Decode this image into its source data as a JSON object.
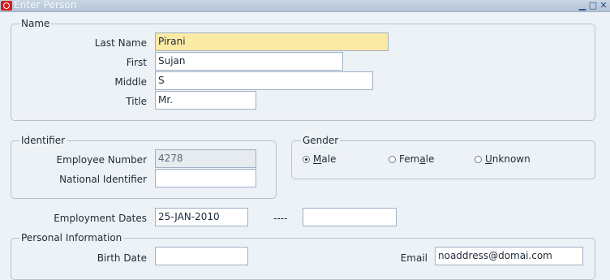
{
  "window": {
    "title": "Enter Person",
    "minimize_glyph": "▁",
    "maximize_glyph": "□",
    "close_glyph": "✕"
  },
  "name_group": {
    "legend": "Name",
    "last_name_label": "Last Name",
    "last_name_value": "Pirani",
    "first_label": "First",
    "first_value": "Sujan",
    "middle_label": "Middle",
    "middle_value": "S",
    "title_label": "Title",
    "title_value": "Mr."
  },
  "identifier_group": {
    "legend": "Identifier",
    "employee_number_label": "Employee Number",
    "employee_number_value": "4278",
    "national_identifier_label": "National Identifier",
    "national_identifier_value": ""
  },
  "gender_group": {
    "legend": "Gender",
    "options": [
      {
        "accel": "M",
        "rest": "ale",
        "selected": true
      },
      {
        "pre": "Fem",
        "accel": "a",
        "rest": "le",
        "selected": false
      },
      {
        "accel": "U",
        "rest": "nknown",
        "selected": false
      }
    ]
  },
  "employment": {
    "label": "Employment Dates",
    "start_value": "25-JAN-2010",
    "separator": "----",
    "end_value": ""
  },
  "personal_group": {
    "legend": "Personal Information",
    "birth_date_label": "Birth Date",
    "birth_date_value": "",
    "email_label": "Email",
    "email_value": "noaddress@domai.com"
  },
  "colors": {
    "required_field": "#fbe9a6",
    "readonly_field": "#e6ebf0",
    "background": "#edf2f7"
  }
}
